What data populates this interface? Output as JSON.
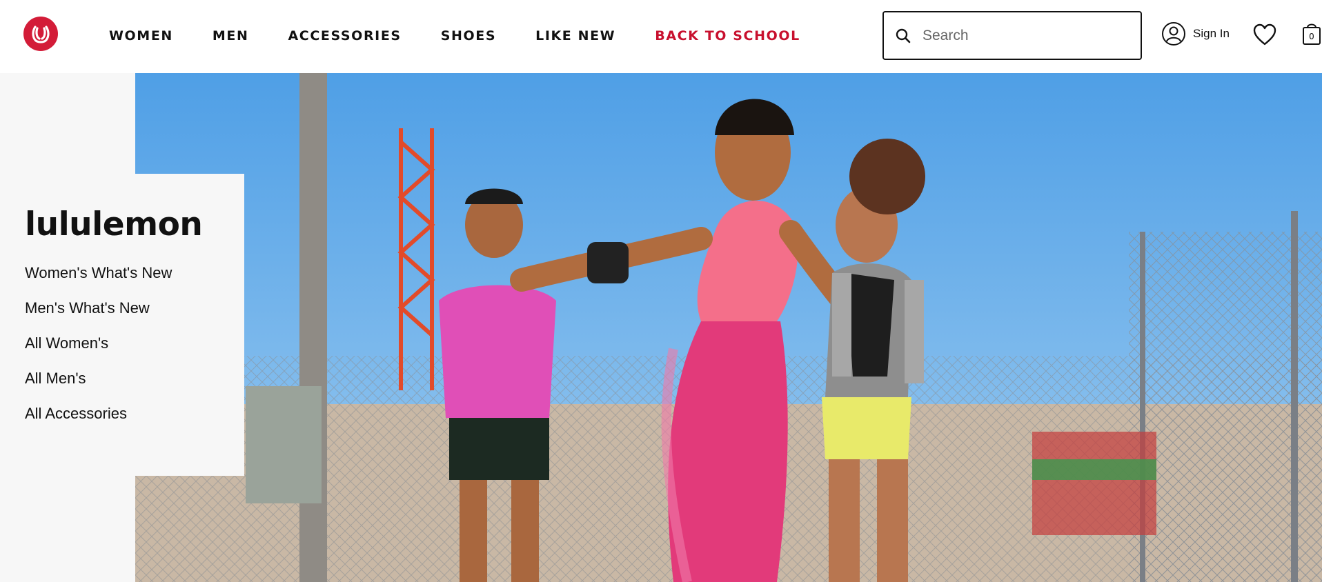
{
  "brand": {
    "logo": "lululemon-logo",
    "color": "#d31c38"
  },
  "nav": {
    "items": [
      {
        "label": "WOMEN"
      },
      {
        "label": "MEN"
      },
      {
        "label": "ACCESSORIES"
      },
      {
        "label": "SHOES"
      },
      {
        "label": "LIKE NEW"
      },
      {
        "label": "BACK TO SCHOOL"
      }
    ],
    "accent_color": "#c8102e"
  },
  "search": {
    "placeholder": "Search",
    "icon": "search-icon"
  },
  "account": {
    "label": "Sign In",
    "icon": "user-icon"
  },
  "wishlist": {
    "icon": "heart-icon"
  },
  "cart": {
    "icon": "shopping-bag-icon",
    "count": "0"
  },
  "hero": {
    "panel": {
      "title": "lululemon",
      "links": [
        {
          "label": "Women's What's New"
        },
        {
          "label": "Men's What's New"
        },
        {
          "label": "All Women's"
        },
        {
          "label": "All Men's"
        },
        {
          "label": "All Accessories"
        }
      ]
    },
    "photo": "three women running outdoors in athletic wear"
  }
}
